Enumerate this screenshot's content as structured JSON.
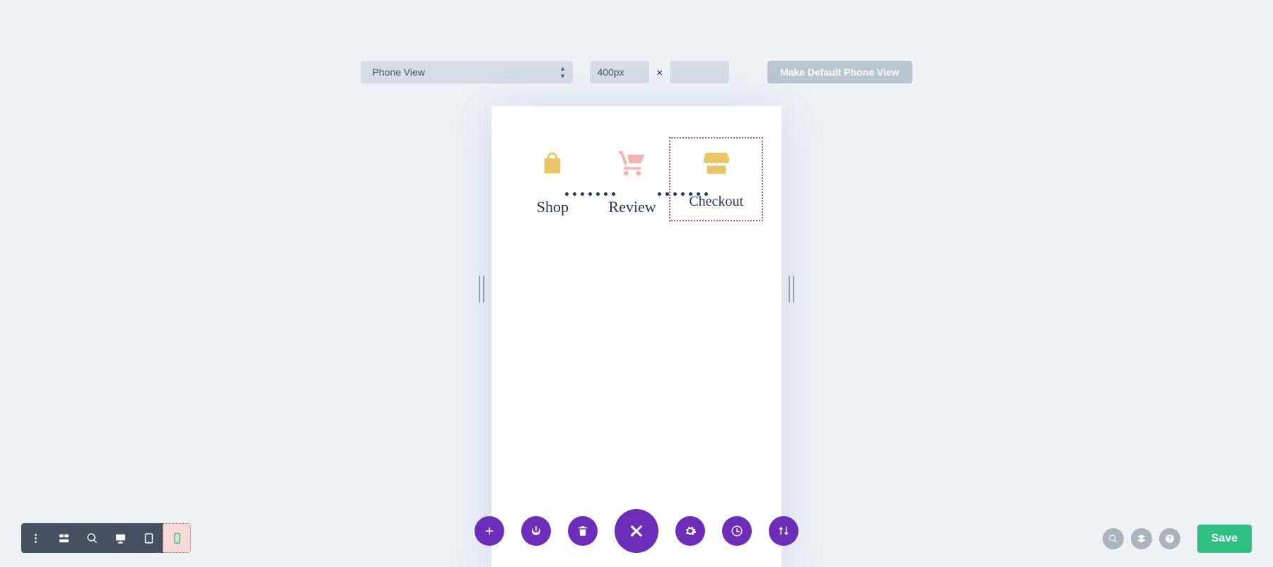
{
  "top": {
    "view_select_value": "Phone View",
    "width_value": "400px",
    "height_value": "",
    "times_glyph": "×",
    "make_default_label": "Make Default Phone View"
  },
  "steps": [
    {
      "label": "Shop",
      "icon": "bag-icon",
      "icon_color": "#eac563",
      "selected": false
    },
    {
      "label": "Review",
      "icon": "cart-icon",
      "icon_color": "#f2b4ae",
      "selected": false
    },
    {
      "label": "Checkout",
      "icon": "store-icon",
      "icon_color": "#eac563",
      "selected": true
    }
  ],
  "colors": {
    "purple": "#6c2eb9",
    "teal": "#2fbf83",
    "gray_circle": "#a8b3be"
  },
  "save_label": "Save"
}
